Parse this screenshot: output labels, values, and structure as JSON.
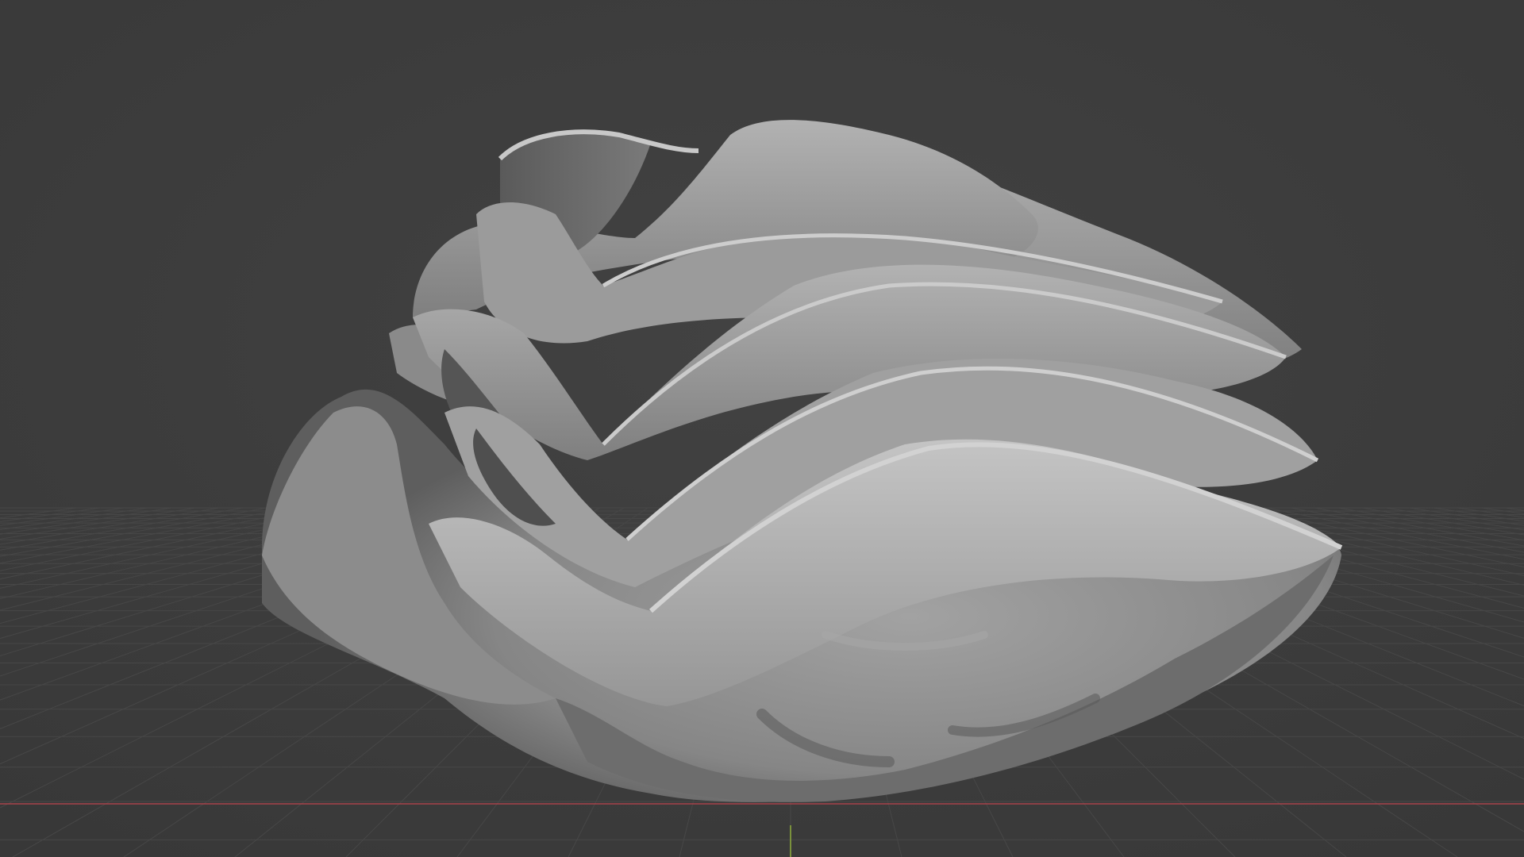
{
  "viewport": {
    "view": "perspective",
    "shading": "solid",
    "background_color": "#3d3d3d",
    "grid_color": "#474747",
    "x_axis_color": "#a8434b",
    "y_axis_color": "#8fae3c",
    "object_base_color": "#8e8e8e",
    "object_highlight_color": "#bcbcbc",
    "object_shadow_color": "#4a4a4a"
  },
  "object": {
    "type": "mesh",
    "description_shape": "ruffled-sculpture"
  }
}
